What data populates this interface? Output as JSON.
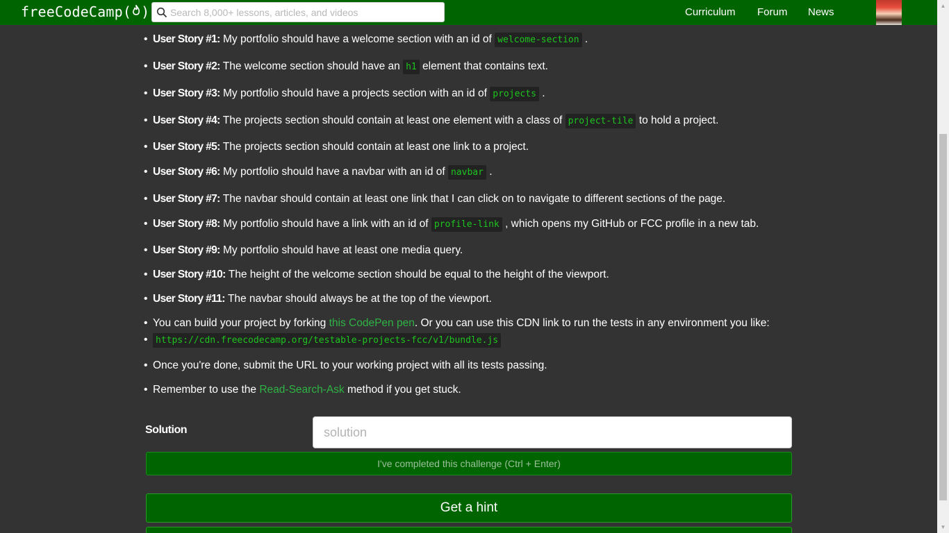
{
  "nav": {
    "logo": "freeCodeCamp(",
    "logo_flame": "🔥",
    "logo_end": ")",
    "search_placeholder": "Search 8,000+ lessons, articles, and videos",
    "links": [
      "Curriculum",
      "Forum",
      "News"
    ]
  },
  "stories": [
    {
      "label": "User Story #1:",
      "pre": " My portfolio should have a welcome section with an id of ",
      "code": "welcome-section",
      "post": " ."
    },
    {
      "label": "User Story #2:",
      "pre": " The welcome section should have an ",
      "code": "h1",
      "post": " element that contains text."
    },
    {
      "label": "User Story #3:",
      "pre": " My portfolio should have a projects section with an id of ",
      "code": "projects",
      "post": " ."
    },
    {
      "label": "User Story #4:",
      "pre": " The projects section should contain at least one element with a class of ",
      "code": "project-tile",
      "post": " to hold a project."
    },
    {
      "label": "User Story #5:",
      "pre": " The projects section should contain at least one link to a project.",
      "code": "",
      "post": ""
    },
    {
      "label": "User Story #6:",
      "pre": " My portfolio should have a navbar with an id of ",
      "code": "navbar",
      "post": " ."
    },
    {
      "label": "User Story #7:",
      "pre": " The navbar should contain at least one link that I can click on to navigate to different sections of the page.",
      "code": "",
      "post": ""
    },
    {
      "label": "User Story #8:",
      "pre": " My portfolio should have a link with an id of ",
      "code": "profile-link",
      "post": " , which opens my GitHub or FCC profile in a new tab."
    },
    {
      "label": "User Story #9:",
      "pre": " My portfolio should have at least one media query.",
      "code": "",
      "post": ""
    },
    {
      "label": "User Story #10:",
      "pre": " The height of the welcome section should be equal to the height of the viewport.",
      "code": "",
      "post": ""
    },
    {
      "label": "User Story #11:",
      "pre": " The navbar should always be at the top of the viewport.",
      "code": "",
      "post": ""
    }
  ],
  "codepen": {
    "pre": "You can build your project by forking ",
    "link": "this CodePen pen",
    "post": ". Or you can use this CDN link to run the tests in any environment you like:",
    "cdn": "https://cdn.freecodecamp.org/testable-projects-fcc/v1/bundle.js"
  },
  "done_text": "Once you're done, submit the URL to your working project with all its tests passing.",
  "rsa": {
    "pre": "Remember to use the ",
    "link": "Read-Search-Ask",
    "post": " method if you get stuck."
  },
  "solution": {
    "label": "Solution",
    "placeholder": "solution"
  },
  "buttons": {
    "complete": "I've completed this challenge (Ctrl + Enter)",
    "hint": "Get a hint"
  }
}
